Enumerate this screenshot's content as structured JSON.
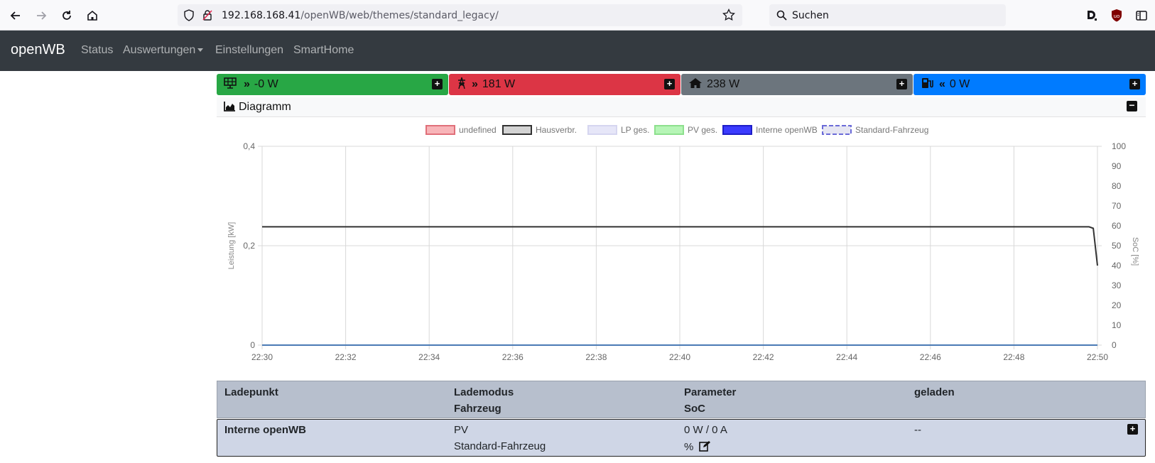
{
  "browser": {
    "url_host": "192.168.168.41",
    "url_path": "/openWB/web/themes/standard_legacy/",
    "search_placeholder": "Suchen"
  },
  "navbar": {
    "brand": "openWB",
    "links": [
      "Status",
      "Auswertungen",
      "Einstellungen",
      "SmartHome"
    ]
  },
  "tiles": [
    {
      "value": "-0 W",
      "color": "#28a745",
      "icon": "solar-panel-icon"
    },
    {
      "value": "181 W",
      "color": "#dc3545",
      "icon": "power-tower-icon"
    },
    {
      "value": "238 W",
      "color": "#6c757d",
      "icon": "house-icon"
    },
    {
      "value": "0 W",
      "color": "#007bff",
      "icon": "charging-station-icon"
    }
  ],
  "diagram": {
    "title": "Diagramm"
  },
  "chart_data": {
    "type": "line",
    "legend": [
      {
        "name": "undefined",
        "fill": "#f8b5b9",
        "stroke": "#e0707a",
        "dashed": false
      },
      {
        "name": "Hausverbr.",
        "fill": "#d3d3d3",
        "stroke": "#333333",
        "dashed": false
      },
      {
        "name": "LP ges.",
        "fill": "#e6e6f8",
        "stroke": "#d6d6f0",
        "dashed": false
      },
      {
        "name": "PV ges.",
        "fill": "#b6f5b6",
        "stroke": "#8ee08e",
        "dashed": false
      },
      {
        "name": "Interne openWB",
        "fill": "#3b3bff",
        "stroke": "#1e1ec8",
        "dashed": false
      },
      {
        "name": "Standard-Fahrzeug",
        "fill": "#e6e6f2",
        "stroke": "#6b6bd8",
        "dashed": true
      }
    ],
    "legend_position": "top",
    "x_ticks": [
      "22:30",
      "22:32",
      "22:34",
      "22:36",
      "22:38",
      "22:40",
      "22:42",
      "22:44",
      "22:46",
      "22:48",
      "22:50"
    ],
    "x_range_minutes": [
      0,
      20
    ],
    "y_left": {
      "label": "Leistung [kW]",
      "ticks": [
        "0",
        "0,2",
        "0,4"
      ],
      "range": [
        0,
        0.4
      ]
    },
    "y_right": {
      "label": "SoC [%]",
      "ticks": [
        "0",
        "10",
        "20",
        "30",
        "40",
        "50",
        "60",
        "70",
        "80",
        "90",
        "100"
      ],
      "range": [
        0,
        100
      ]
    },
    "grid": true,
    "series": [
      {
        "name": "Hausverbr.",
        "color": "#333333",
        "points": [
          [
            0,
            0.238
          ],
          [
            19.8,
            0.238
          ],
          [
            19.9,
            0.235
          ],
          [
            20.0,
            0.16
          ]
        ]
      },
      {
        "name": "Interne openWB",
        "color": "#4a7ab5",
        "points": [
          [
            0,
            0.0
          ],
          [
            20.0,
            0.0
          ]
        ]
      }
    ]
  },
  "table": {
    "headers": [
      {
        "top": "Ladepunkt",
        "bottom": ""
      },
      {
        "top": "Lademodus",
        "bottom": "Fahrzeug"
      },
      {
        "top": "Parameter",
        "bottom": "SoC"
      },
      {
        "top": "geladen",
        "bottom": ""
      }
    ],
    "row": {
      "ladepunkt": "Interne openWB",
      "lademodus": "PV",
      "fahrzeug": "Standard-Fahrzeug",
      "parameter": "0 W / 0 A",
      "soc": "%",
      "geladen": "--"
    }
  }
}
